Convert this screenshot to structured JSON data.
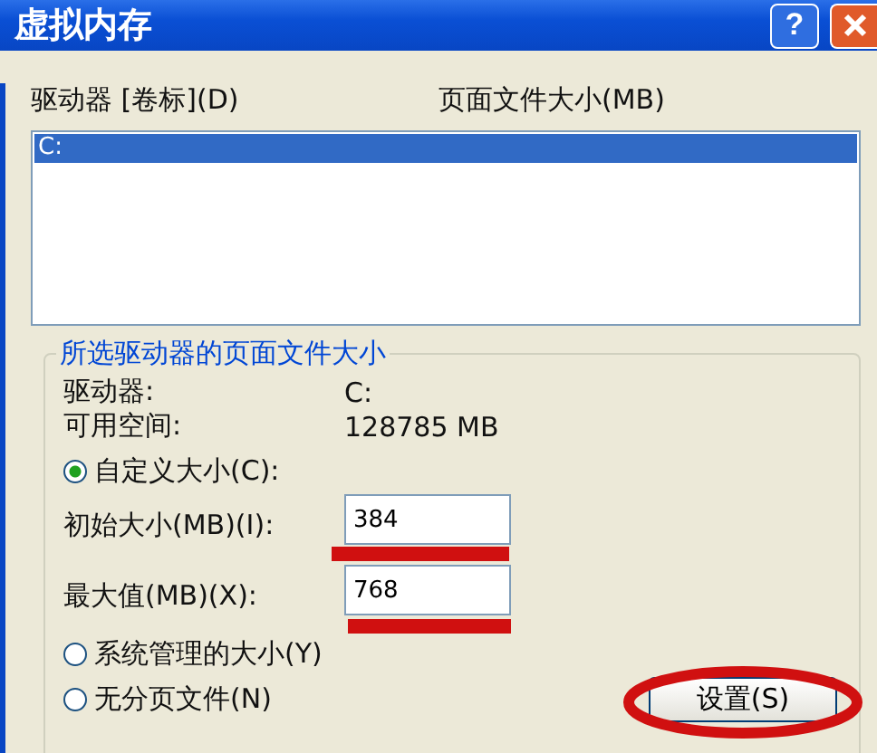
{
  "window": {
    "title": "虚拟内存",
    "help_button": "?"
  },
  "drive_list": {
    "columns": [
      "驱动器 [卷标](D)",
      "页面文件大小(MB)"
    ],
    "rows": [
      {
        "drive": "C:",
        "selected": true
      }
    ]
  },
  "group": {
    "title": "所选驱动器的页面文件大小",
    "info": [
      {
        "label": "驱动器:",
        "value": "C:"
      },
      {
        "label": "可用空间:",
        "value": "128785 MB"
      }
    ],
    "custom_radio": {
      "label": "自定义大小(C):",
      "selected": true
    },
    "fields": [
      {
        "label": "初始大小(MB)(I):",
        "value": "384"
      },
      {
        "label": "最大值(MB)(X):",
        "value": "768"
      }
    ],
    "radios": [
      {
        "label": "系统管理的大小(Y)",
        "selected": false
      },
      {
        "label": "无分页文件(N)",
        "selected": false
      }
    ],
    "set_button": "设置(S)"
  }
}
